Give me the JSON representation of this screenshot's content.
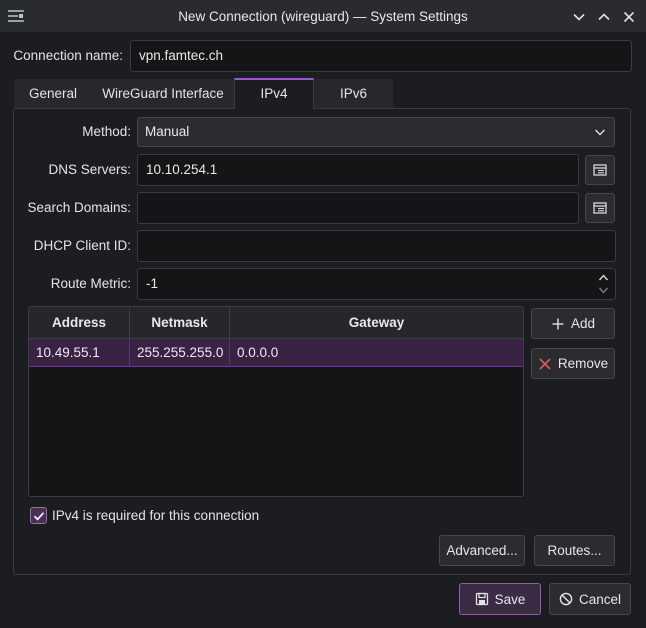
{
  "window": {
    "title": "New Connection (wireguard) — System Settings"
  },
  "connection_name": {
    "label": "Connection name:",
    "value": "vpn.famtec.ch"
  },
  "tabs": [
    {
      "label": "General",
      "active": false
    },
    {
      "label": "WireGuard Interface",
      "active": false
    },
    {
      "label": "IPv4",
      "active": true
    },
    {
      "label": "IPv6",
      "active": false
    }
  ],
  "ipv4": {
    "method": {
      "label": "Method:",
      "value": "Manual"
    },
    "dns_servers": {
      "label": "DNS Servers:",
      "value": "10.10.254.1"
    },
    "search_domains": {
      "label": "Search Domains:",
      "value": ""
    },
    "dhcp_client_id": {
      "label": "DHCP Client ID:",
      "value": ""
    },
    "route_metric": {
      "label": "Route Metric:",
      "value": "-1"
    },
    "addresses": {
      "columns": [
        "Address",
        "Netmask",
        "Gateway"
      ],
      "rows": [
        {
          "address": "10.49.55.1",
          "netmask": "255.255.255.0",
          "gateway": "0.0.0.0",
          "selected": true
        }
      ]
    },
    "add_label": "Add",
    "remove_label": "Remove",
    "required_checkbox": {
      "label": "IPv4 is required for this connection",
      "checked": true
    },
    "advanced_label": "Advanced...",
    "routes_label": "Routes..."
  },
  "footer": {
    "save_label": "Save",
    "cancel_label": "Cancel"
  },
  "colors": {
    "accent": "#9b59d0",
    "selection": "#3a2245",
    "background": "#1c1d20",
    "remove_icon": "#e0585b"
  },
  "icons": [
    "app-icon",
    "chevron-down-icon",
    "chevron-up-icon",
    "close-icon",
    "list-edit-icon",
    "plus-icon",
    "remove-x-icon",
    "check-icon",
    "save-disk-icon",
    "cancel-circle-icon"
  ]
}
